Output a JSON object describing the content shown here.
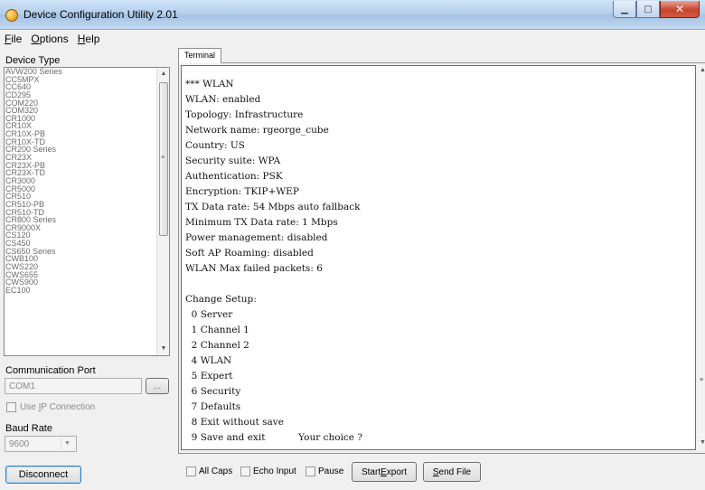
{
  "window": {
    "title": "Device Configuration Utility 2.01"
  },
  "menu": [
    {
      "label_ul": "F",
      "label_rest": "ile"
    },
    {
      "label_ul": "O",
      "label_rest": "ptions"
    },
    {
      "label_ul": "H",
      "label_rest": "elp"
    }
  ],
  "left": {
    "device_type_label": "Device Type",
    "devices": [
      "AVW200 Series",
      "CC5MPX",
      "CC640",
      "CD295",
      "COM220",
      "COM320",
      "CR1000",
      "CR10X",
      "CR10X-PB",
      "CR10X-TD",
      "CR200 Series",
      "CR23X",
      "CR23X-PB",
      "CR23X-TD",
      "CR3000",
      "CR5000",
      "CR510",
      "CR510-PB",
      "CR510-TD",
      "CR800 Series",
      "CR9000X",
      "CS120",
      "CS450",
      "CS650 Series",
      "CWB100",
      "CWS220",
      "CWS655",
      "CWS900",
      "EC100"
    ],
    "comm_port_label": "Communication Port",
    "comm_port_value": "COM1",
    "browse_label": "...",
    "use_ip_label_pre": "Use ",
    "use_ip_label_ul": "I",
    "use_ip_label_post": "P Connection",
    "baud_rate_label": "Baud Rate",
    "baud_rate_value": "9600",
    "disconnect_label": "Disconnect"
  },
  "terminal": {
    "tab_label": "Terminal",
    "lines": [
      "*** WLAN",
      "WLAN: enabled",
      "Topology: Infrastructure",
      "Network name: rgeorge_cube",
      "Country: US",
      "Security suite: WPA",
      "Authentication: PSK",
      "Encryption: TKIP+WEP",
      "TX Data rate: 54 Mbps auto fallback",
      "Minimum TX Data rate: 1 Mbps",
      "Power management: disabled",
      "Soft AP Roaming: disabled",
      "WLAN Max failed packets: 6",
      "",
      "Change Setup:",
      "  0 Server",
      "  1 Channel 1",
      "  2 Channel 2",
      "  4 WLAN",
      "  5 Expert",
      "  6 Security",
      "  7 Defaults",
      "  8 Exit without save",
      "  9 Save and exit           Your choice ?"
    ]
  },
  "bottom": {
    "all_caps_label": "All Caps",
    "echo_input_label": "Echo Input",
    "pause_label": "Pause",
    "start_export_pre": "Start ",
    "start_export_ul": "E",
    "start_export_post": "xport",
    "send_file_ul": "S",
    "send_file_post": "end File"
  }
}
